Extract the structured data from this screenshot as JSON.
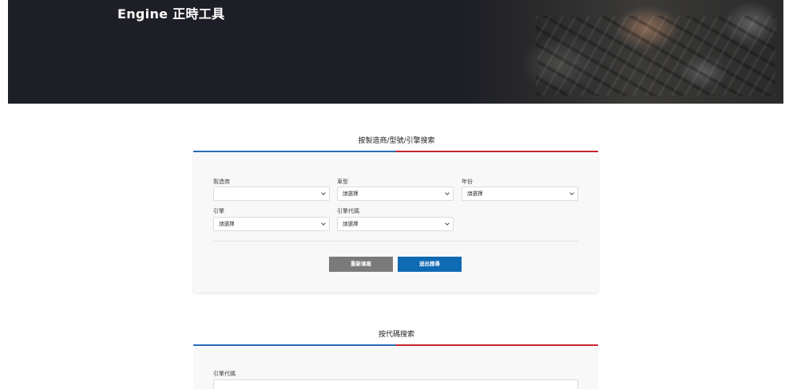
{
  "hero": {
    "title": "Engine 正時工具"
  },
  "search_by_model": {
    "heading": "按製造商/型號/引擎搜索",
    "fields": [
      {
        "label": "製造商",
        "value": ""
      },
      {
        "label": "車型",
        "value": "請選擇"
      },
      {
        "label": "年份",
        "value": "請選擇"
      },
      {
        "label": "引擎",
        "value": "請選擇"
      },
      {
        "label": "引擎代碼",
        "value": "請選擇"
      }
    ],
    "reset_label": "重新填寫",
    "submit_label": "送出搜尋"
  },
  "search_by_code": {
    "heading": "按代碼搜索",
    "field_label": "引擎代碼"
  },
  "colors": {
    "divider_left": "#2a6db5",
    "divider_right": "#c8262f",
    "submit": "#0f6ab4",
    "reset": "#7a7a7a"
  }
}
